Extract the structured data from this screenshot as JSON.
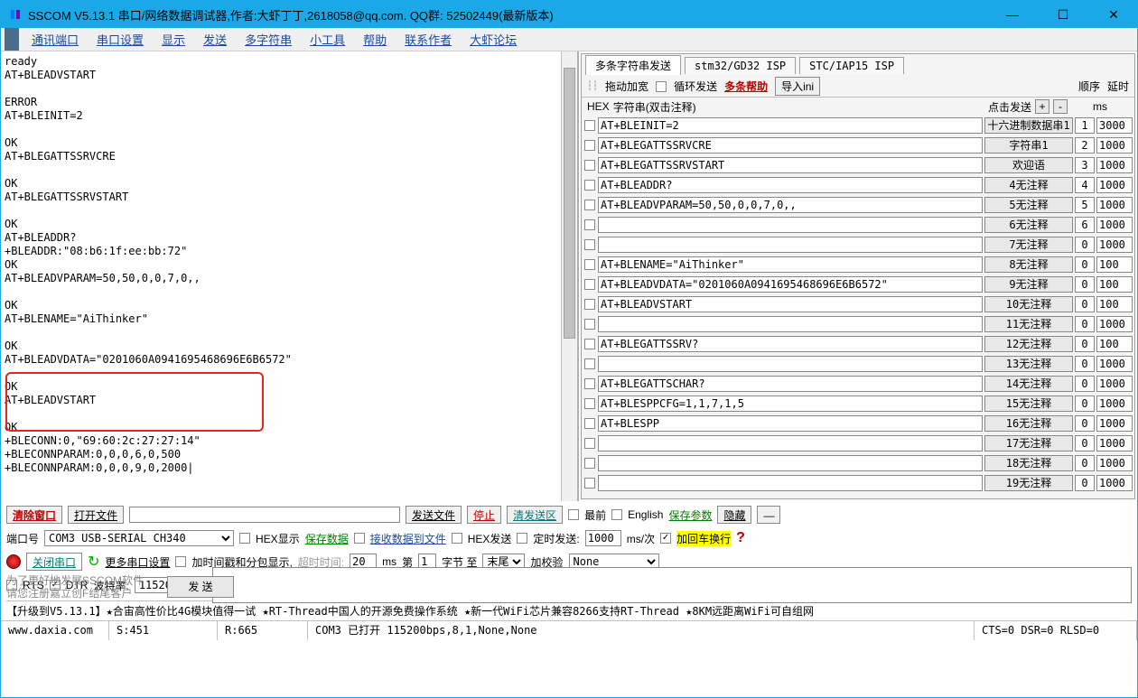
{
  "window": {
    "title": "SSCOM V5.13.1 串口/网络数据调试器,作者:大虾丁丁,2618058@qq.com. QQ群: 52502449(最新版本)"
  },
  "menu": {
    "items": [
      "通讯端口",
      "串口设置",
      "显示",
      "发送",
      "多字符串",
      "小工具",
      "帮助",
      "联系作者",
      "大虾论坛"
    ]
  },
  "terminal": "ready\nAT+BLEADVSTART\n\nERROR\nAT+BLEINIT=2\n\nOK\nAT+BLEGATTSSRVCRE\n\nOK\nAT+BLEGATTSSRVSTART\n\nOK\nAT+BLEADDR?\n+BLEADDR:\"08:b6:1f:ee:bb:72\"\nOK\nAT+BLEADVPARAM=50,50,0,0,7,0,,\n\nOK\nAT+BLENAME=\"AiThinker\"\n\nOK\nAT+BLEADVDATA=\"0201060A0941695468696E6B6572\"\n\nOK\nAT+BLEADVSTART\n\nOK\n+BLECONN:0,\"69:60:2c:27:27:14\"\n+BLECONNPARAM:0,0,0,6,0,500\n+BLECONNPARAM:0,0,0,9,0,2000|",
  "right_panel": {
    "tabs": [
      "多条字符串发送",
      "stm32/GD32 ISP",
      "STC/IAP15 ISP"
    ],
    "toolbar": {
      "drag": "拖动加宽",
      "loop_send": "循环发送",
      "multi_help": "多条帮助",
      "import": "导入ini",
      "order": "顺序",
      "delay": "延时"
    },
    "grid_header": {
      "hex_label": "HEX",
      "string_label": "字符串(双击注释)",
      "click_send": "点击发送",
      "ms": "ms"
    },
    "rows": [
      {
        "cmd": "AT+BLEINIT=2",
        "btn": "十六进制数据串1",
        "seq": "1",
        "delay": "3000"
      },
      {
        "cmd": "AT+BLEGATTSSRVCRE",
        "btn": "字符串1",
        "seq": "2",
        "delay": "1000"
      },
      {
        "cmd": "AT+BLEGATTSSRVSTART",
        "btn": "欢迎语",
        "seq": "3",
        "delay": "1000"
      },
      {
        "cmd": "AT+BLEADDR?",
        "btn": "4无注释",
        "seq": "4",
        "delay": "1000"
      },
      {
        "cmd": "AT+BLEADVPARAM=50,50,0,0,7,0,,",
        "btn": "5无注释",
        "seq": "5",
        "delay": "1000"
      },
      {
        "cmd": "",
        "btn": "6无注释",
        "seq": "6",
        "delay": "1000"
      },
      {
        "cmd": "",
        "btn": "7无注释",
        "seq": "0",
        "delay": "1000"
      },
      {
        "cmd": "AT+BLENAME=\"AiThinker\"",
        "btn": "8无注释",
        "seq": "0",
        "delay": "100"
      },
      {
        "cmd": "AT+BLEADVDATA=\"0201060A0941695468696E6B6572\"",
        "btn": "9无注释",
        "seq": "0",
        "delay": "100"
      },
      {
        "cmd": "AT+BLEADVSTART",
        "btn": "10无注释",
        "seq": "0",
        "delay": "100"
      },
      {
        "cmd": "",
        "btn": "11无注释",
        "seq": "0",
        "delay": "1000"
      },
      {
        "cmd": "AT+BLEGATTSSRV?",
        "btn": "12无注释",
        "seq": "0",
        "delay": "100"
      },
      {
        "cmd": "",
        "btn": "13无注释",
        "seq": "0",
        "delay": "1000"
      },
      {
        "cmd": "AT+BLEGATTSCHAR?",
        "btn": "14无注释",
        "seq": "0",
        "delay": "1000"
      },
      {
        "cmd": "AT+BLESPPCFG=1,1,7,1,5",
        "btn": "15无注释",
        "seq": "0",
        "delay": "1000"
      },
      {
        "cmd": "AT+BLESPP",
        "btn": "16无注释",
        "seq": "0",
        "delay": "1000"
      },
      {
        "cmd": "",
        "btn": "17无注释",
        "seq": "0",
        "delay": "1000"
      },
      {
        "cmd": "",
        "btn": "18无注释",
        "seq": "0",
        "delay": "1000"
      },
      {
        "cmd": "",
        "btn": "19无注释",
        "seq": "0",
        "delay": "1000"
      }
    ]
  },
  "controls": {
    "clear_window": "清除窗口",
    "open_file": "打开文件",
    "send_file": "发送文件",
    "stop": "停止",
    "clear_send": "清发送区",
    "topmost": "最前",
    "english": "English",
    "save_params": "保存参数",
    "hide": "隐藏",
    "minimize": "—",
    "port_label": "端口号",
    "port_value": "COM3 USB-SERIAL CH340",
    "hex_display": "HEX显示",
    "save_data": "保存数据",
    "recv_to_file": "接收数据到文件",
    "hex_send": "HEX发送",
    "timed_send": "定时发送:",
    "timed_value": "1000",
    "timed_unit": "ms/次",
    "add_crlf": "加回车换行",
    "close_port": "关闭串口",
    "more_settings": "更多串口设置",
    "add_timestamp": "加时间戳和分包显示,",
    "timeout_label": "超时时间:",
    "timeout_value": "20",
    "timeout_unit": "ms",
    "frame_label": "第",
    "frame_value": "1",
    "byte_label": "字节 至",
    "tail_value": "末尾",
    "checksum_label": "加校验",
    "checksum_value": "None",
    "rts": "RTS",
    "dtr": "DTR",
    "baud_label": "波特率:",
    "baud_value": "115200",
    "promo1": "为了更好地发展SSCOM软件",
    "promo2": "请您注册嘉立创F结尾客户",
    "send_btn": "发   送",
    "banner": "【升级到V5.13.1】★合宙高性价比4G模块值得一试 ★RT-Thread中国人的开源免费操作系统 ★新一代WiFi芯片兼容8266支持RT-Thread ★8KM远距离WiFi可自组网"
  },
  "status": {
    "url": "www.daxia.com",
    "s": "S:451",
    "r": "R:665",
    "conn": "COM3 已打开 115200bps,8,1,None,None",
    "cts": "CTS=0 DSR=0 RLSD=0"
  }
}
